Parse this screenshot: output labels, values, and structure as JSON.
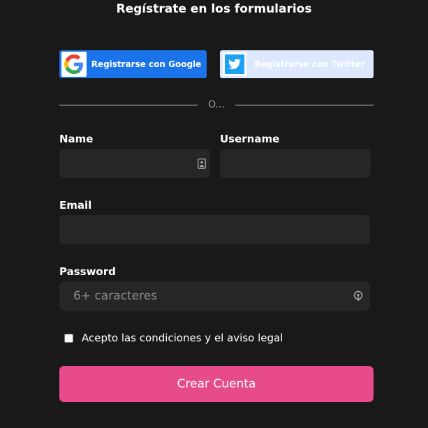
{
  "form": {
    "title": "Regístrate en los formularios",
    "divider_text": "O...",
    "google_button": {
      "label": "Registrarse con Google",
      "icon": "google-icon"
    },
    "twitter_button": {
      "label": "Registrarse con Twitter",
      "icon": "twitter-icon"
    },
    "fields": {
      "name": {
        "label": "Name",
        "value": "",
        "placeholder": "",
        "icon": "contact-card-icon"
      },
      "username": {
        "label": "Username",
        "value": "",
        "placeholder": ""
      },
      "email": {
        "label": "Email",
        "value": "",
        "placeholder": ""
      },
      "password": {
        "label": "Password",
        "value": "",
        "placeholder": "6+ caracteres",
        "icon": "password-key-icon"
      }
    },
    "terms": {
      "label": "Acepto las condiciones y el aviso legal",
      "checked": false
    },
    "submit_label": "Crear Cuenta"
  },
  "colors": {
    "background": "#191919",
    "input_background": "#262626",
    "google_blue": "#1a73e8",
    "twitter_button_bg": "#dde8ff",
    "twitter_blue": "#1da1f2",
    "submit_pink": "#e84b8a"
  }
}
